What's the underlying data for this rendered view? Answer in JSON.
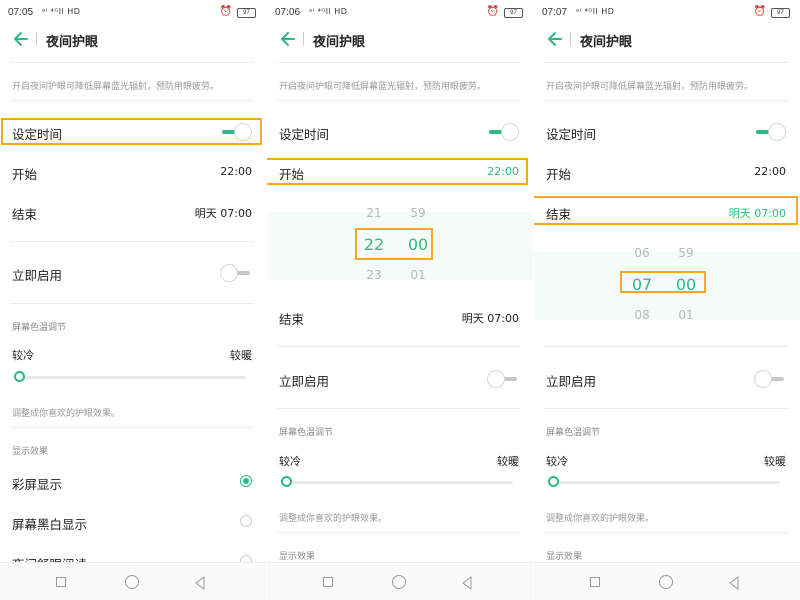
{
  "panels": [
    {
      "status": {
        "time": "07:05",
        "signal": "ᵃᴵ ⁴ᴳll HD",
        "battery": "97"
      },
      "title": "夜间护眼",
      "description": "开启夜间护眼可降低屏幕蓝光辐射，预防用眼疲劳。",
      "set_time": {
        "label": "设定时间",
        "switch": "on"
      },
      "start": {
        "label": "开始",
        "value": "22:00"
      },
      "end": {
        "label": "结束",
        "value": "明天 07:00"
      },
      "enable_now": {
        "label": "立即启用",
        "switch": "off"
      },
      "color_temp": {
        "section": "屏幕色温调节",
        "cool": "较冷",
        "warm": "较暖",
        "level": 0,
        "hint": "调整成你喜欢的护眼效果。"
      },
      "display": {
        "section": "显示效果",
        "options": [
          {
            "label": "彩屏显示",
            "selected": true
          },
          {
            "label": "屏幕黑白显示",
            "selected": false
          },
          {
            "label": "夜间舒眼阅读",
            "selected": false
          }
        ]
      }
    },
    {
      "status": {
        "time": "07:06",
        "signal": "ᵃᴵ ⁴ᴳll HD",
        "battery": "97"
      },
      "title": "夜间护眼",
      "description": "开启夜间护眼可降低屏幕蓝光辐射，预防用眼疲劳。",
      "set_time": {
        "label": "设定时间",
        "switch": "on"
      },
      "start": {
        "label": "开始",
        "value": "22:00"
      },
      "picker": {
        "hours": [
          "21",
          "22",
          "23"
        ],
        "minutes": [
          "59",
          "00",
          "01"
        ]
      },
      "end": {
        "label": "结束",
        "value": "明天 07:00"
      },
      "enable_now": {
        "label": "立即启用",
        "switch": "off"
      },
      "color_temp": {
        "section": "屏幕色温调节",
        "cool": "较冷",
        "warm": "较暖",
        "level": 0,
        "hint": "调整成你喜欢的护眼效果。"
      },
      "display": {
        "section": "显示效果"
      }
    },
    {
      "status": {
        "time": "07:07",
        "signal": "ᵃᴵ ⁴ᴳll HD",
        "battery": "97"
      },
      "title": "夜间护眼",
      "description": "开启夜间护眼可降低屏幕蓝光辐射，预防用眼疲劳。",
      "set_time": {
        "label": "设定时间",
        "switch": "on"
      },
      "start": {
        "label": "开始",
        "value": "22:00"
      },
      "end": {
        "label": "结束",
        "value": "明天 07:00"
      },
      "picker": {
        "hours": [
          "06",
          "07",
          "08"
        ],
        "minutes": [
          "59",
          "00",
          "01"
        ]
      },
      "enable_now": {
        "label": "立即启用",
        "switch": "off"
      },
      "color_temp": {
        "section": "屏幕色温调节",
        "cool": "较冷",
        "warm": "较暖",
        "level": 0,
        "hint": "调整成你喜欢的护眼效果。"
      },
      "display": {
        "section": "显示效果"
      }
    }
  ],
  "colors": {
    "accent": "#2fb981",
    "highlight": "#f5a623"
  },
  "icons": {
    "back": "back-arrow-icon",
    "alarm": "alarm-icon",
    "nav_recent": "square-icon",
    "nav_home": "circle-icon",
    "nav_back": "triangle-back-icon"
  }
}
